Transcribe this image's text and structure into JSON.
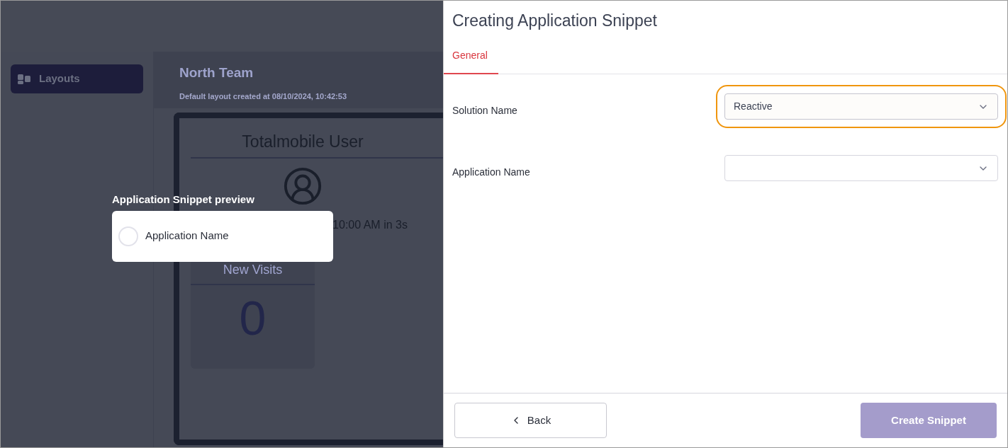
{
  "sidebar": {
    "items": [
      {
        "label": "Layouts",
        "selected": true
      }
    ]
  },
  "layout_header": {
    "title": "North Team",
    "subtitle": "Default layout created at 08/10/2024, 10:42:53"
  },
  "dashboard": {
    "user_card": {
      "title": "Totalmobile User",
      "status": "10:00 AM in 3s"
    },
    "visits_card": {
      "title": "New Visits",
      "value": "0"
    }
  },
  "preview": {
    "title": "Application Snippet preview",
    "item": {
      "label": "Application Name",
      "checked": false
    }
  },
  "dialog": {
    "title": "Creating Application Snippet",
    "tabs": [
      {
        "label": "General",
        "selected": true
      }
    ],
    "fields": [
      {
        "label": "Solution Name",
        "value": "Reactive",
        "focused": true
      },
      {
        "label": "Application Name",
        "focused": false
      }
    ],
    "buttons": [
      {
        "label": "Back",
        "kind": "back",
        "disabled": false
      },
      {
        "label": "Create Snippet",
        "kind": "primary",
        "disabled": true
      }
    ]
  }
}
